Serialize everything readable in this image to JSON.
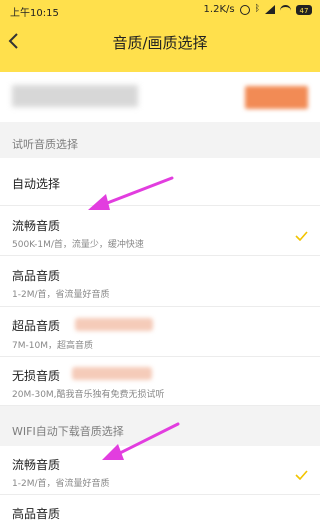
{
  "status_bar": {
    "time": "上午10:15",
    "network_speed": "1.2K/s",
    "battery": "47"
  },
  "header": {
    "title": "音质/画质选择"
  },
  "colors": {
    "header_bg": "#ffe04c",
    "check": "#f2c400",
    "arrow": "#e23ddf"
  },
  "trial_section": {
    "header": "试听音质选择",
    "options": [
      {
        "title": "自动选择",
        "subtitle": "",
        "selected": false
      },
      {
        "title": "流畅音质",
        "subtitle": "500K-1M/首，流量少，缓冲快速",
        "selected": true
      },
      {
        "title": "高品音质",
        "subtitle": "1-2M/首，省流量好音质",
        "selected": false
      },
      {
        "title": "超品音质",
        "subtitle": "7M-10M，超高音质",
        "selected": false
      },
      {
        "title": "无损音质",
        "subtitle": "20M-30M,酷我音乐独有免费无损试听",
        "selected": false
      }
    ]
  },
  "wifi_section": {
    "header": "WIFI自动下载音质选择",
    "options": [
      {
        "title": "流畅音质",
        "subtitle": "1-2M/首，省流量好音质",
        "selected": true
      },
      {
        "title": "高品音质",
        "subtitle": "",
        "selected": false
      }
    ]
  }
}
